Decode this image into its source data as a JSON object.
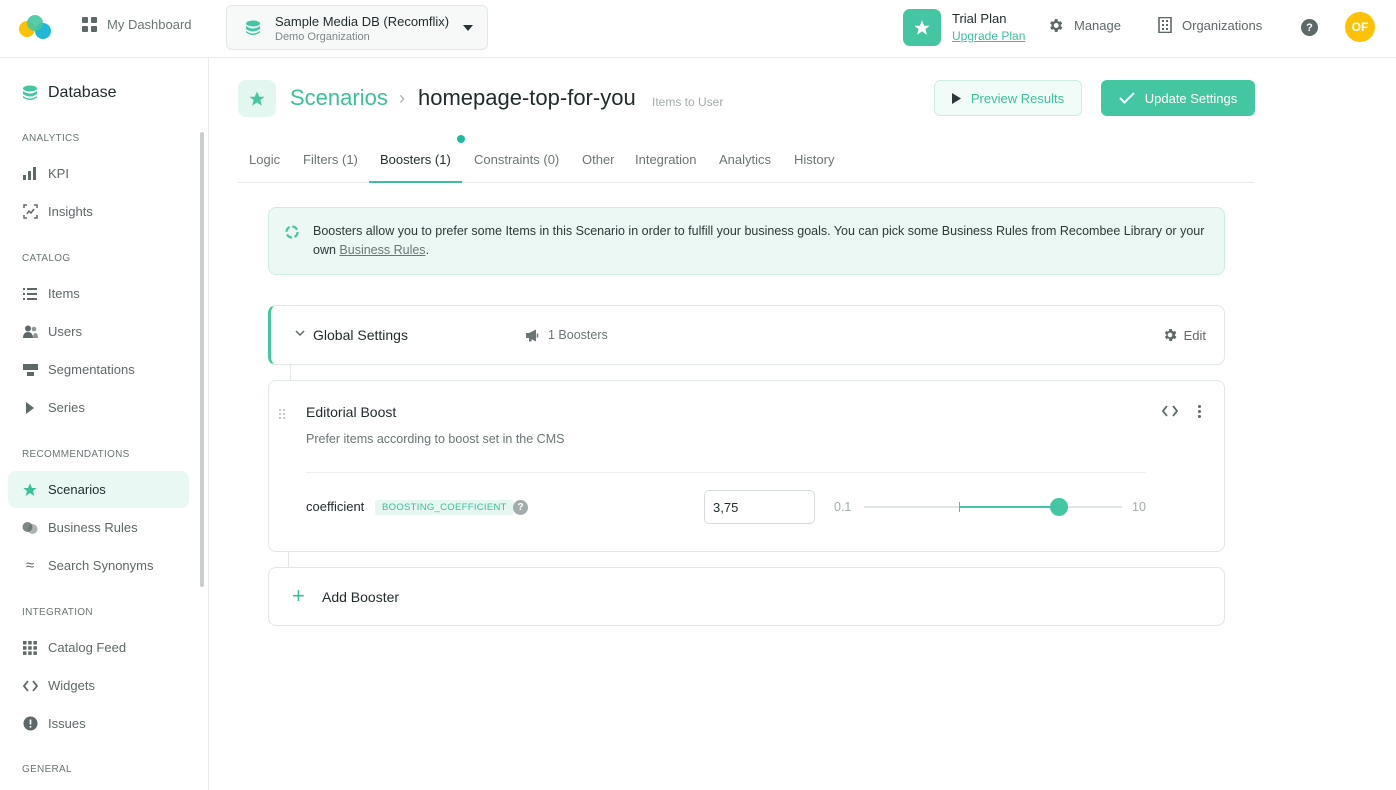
{
  "header": {
    "my_dashboard": "My Dashboard",
    "db_name": "Sample Media DB (Recomflix)",
    "db_org": "Demo Organization",
    "plan_title": "Trial Plan",
    "plan_link": "Upgrade Plan",
    "manage": "Manage",
    "organizations": "Organizations",
    "help": "?",
    "avatar_initials": "OF"
  },
  "sidebar": {
    "title": "Database",
    "sections": {
      "analytics": "ANALYTICS",
      "catalog": "CATALOG",
      "recommendations": "RECOMMENDATIONS",
      "integration": "INTEGRATION",
      "general": "GENERAL"
    },
    "items": {
      "kpi": "KPI",
      "insights": "Insights",
      "items": "Items",
      "users": "Users",
      "segmentations": "Segmentations",
      "series": "Series",
      "scenarios": "Scenarios",
      "business_rules": "Business Rules",
      "search_synonyms": "Search Synonyms",
      "catalog_feed": "Catalog Feed",
      "widgets": "Widgets",
      "issues": "Issues"
    }
  },
  "page": {
    "crumb_root": "Scenarios",
    "crumb_sep": "›",
    "scenario_name": "homepage-top-for-you",
    "scenario_type": "Items to User",
    "preview_label": "Preview Results",
    "update_label": "Update Settings"
  },
  "tabs": {
    "logic": "Logic",
    "filters": "Filters (1)",
    "boosters": "Boosters (1)",
    "constraints": "Constraints (0)",
    "other": "Other",
    "integration": "Integration",
    "analytics": "Analytics",
    "history": "History"
  },
  "info": {
    "text": "Boosters allow you to prefer some Items in this Scenario in order to fulfill your business goals. You can pick some Business Rules from Recombee Library or your own ",
    "link": "Business Rules",
    "end": "."
  },
  "global_settings": {
    "title": "Global Settings",
    "boosters_count": "1 Boosters",
    "edit": "Edit"
  },
  "booster": {
    "title": "Editorial Boost",
    "description": "Prefer items according to boost set in the CMS",
    "param_name": "coefficient",
    "param_tag": "BOOSTING_COEFFICIENT",
    "param_help": "?",
    "value": "3,75",
    "min_label": "0.1",
    "max_label": "10",
    "slider": {
      "min": 0.1,
      "max": 10,
      "value": 7.6,
      "mark": 3.75
    }
  },
  "add_booster": {
    "plus": "+",
    "label": "Add Booster"
  },
  "colors": {
    "accent": "#45c6a2",
    "accent_text": "#3dbf9a",
    "avatar": "#ffc107"
  }
}
